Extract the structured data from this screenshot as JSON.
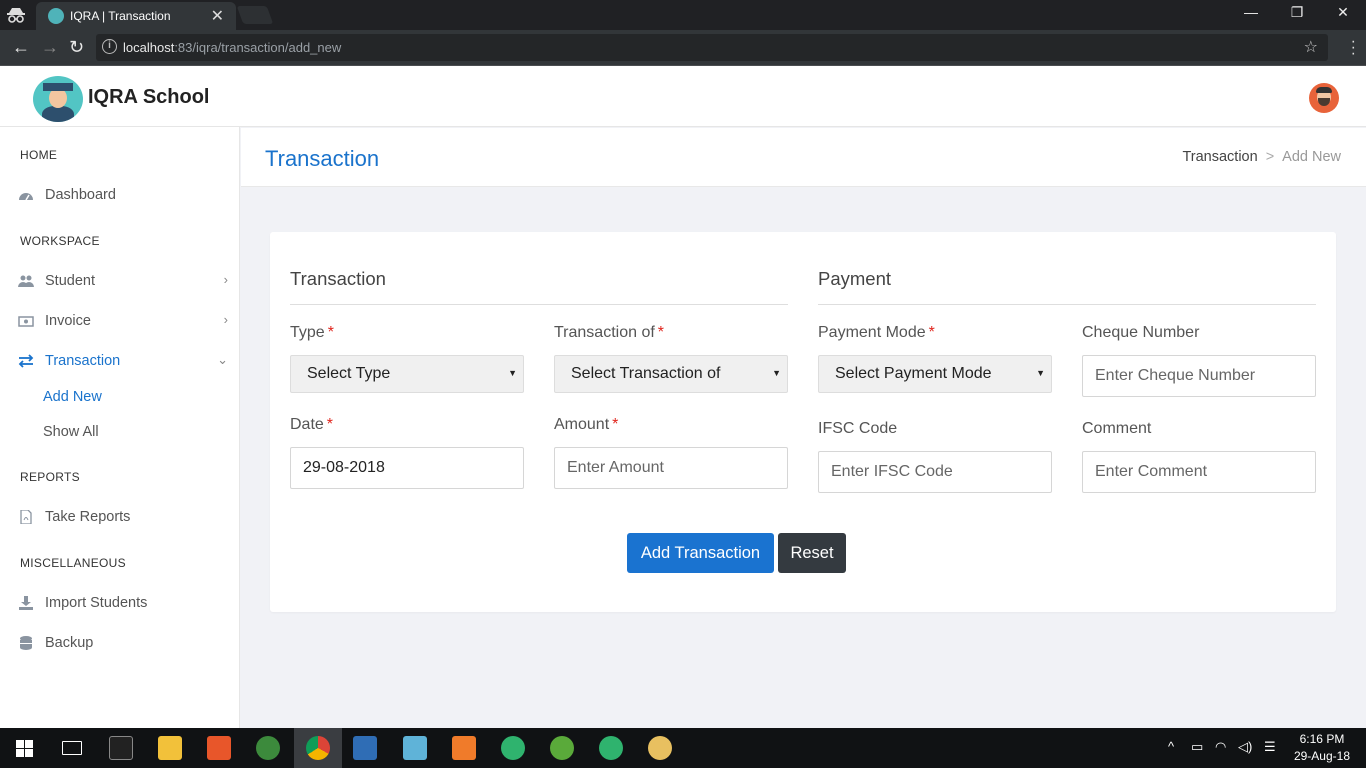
{
  "browser": {
    "tab_title": "IQRA | Transaction",
    "tab_close": "✕",
    "url_host": "localhost",
    "url_rest": ":83/iqra/transaction/add_new",
    "controls": {
      "minimize": "—",
      "restore": "❐",
      "close": "✕"
    },
    "back": "←",
    "forward": "→",
    "reload": "↻",
    "star": "☆",
    "info": "i"
  },
  "app": {
    "brand": "IQRA School"
  },
  "sidebar": {
    "sections": [
      {
        "heading": "HOME"
      },
      {
        "heading": "WORKSPACE"
      },
      {
        "heading": "REPORTS"
      },
      {
        "heading": "MISCELLANEOUS"
      }
    ],
    "items": [
      {
        "label": "Dashboard",
        "icon": "dashboard-icon"
      },
      {
        "label": "Student",
        "icon": "users-icon",
        "chevron": "›"
      },
      {
        "label": "Invoice",
        "icon": "money-icon",
        "chevron": "›"
      },
      {
        "label": "Transaction",
        "icon": "exchange-icon",
        "chevron": "⌄"
      },
      {
        "label": "Take Reports",
        "icon": "file-pdf-icon"
      },
      {
        "label": "Import Students",
        "icon": "download-icon"
      },
      {
        "label": "Backup",
        "icon": "database-icon"
      }
    ],
    "sub_items": [
      {
        "label": "Add New"
      },
      {
        "label": "Show All"
      }
    ]
  },
  "page": {
    "title": "Transaction",
    "breadcrumb": {
      "parent": "Transaction",
      "sep": ">",
      "current": "Add New"
    }
  },
  "form": {
    "transaction_section": "Transaction",
    "payment_section": "Payment",
    "required_mark": "*",
    "type": {
      "label": "Type",
      "value": "Select Type"
    },
    "transaction_of": {
      "label": "Transaction of",
      "value": "Select Transaction of"
    },
    "payment_mode": {
      "label": "Payment Mode",
      "value": "Select Payment Mode"
    },
    "cheque_number": {
      "label": "Cheque Number",
      "placeholder": "Enter Cheque Number"
    },
    "date": {
      "label": "Date",
      "value": "29-08-2018"
    },
    "amount": {
      "label": "Amount",
      "placeholder": "Enter Amount"
    },
    "ifsc": {
      "label": "IFSC Code",
      "placeholder": "Enter IFSC Code"
    },
    "comment": {
      "label": "Comment",
      "placeholder": "Enter Comment"
    },
    "submit_label": "Add Transaction",
    "reset_label": "Reset",
    "select_arrow": "▼"
  },
  "taskbar": {
    "time": "6:16 PM",
    "date": "29-Aug-18"
  },
  "colors": {
    "accent": "#1a73cc",
    "required": "#e0241c",
    "reset_button": "#343a40"
  }
}
